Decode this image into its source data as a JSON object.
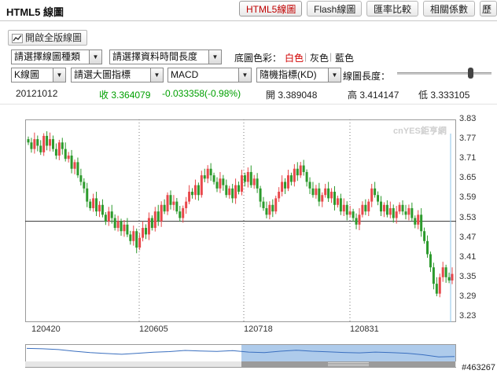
{
  "header": {
    "title": "HTML5 線圖",
    "tabs": [
      {
        "label": "HTML5線圖",
        "active": true
      },
      {
        "label": "Flash線圖",
        "active": false
      },
      {
        "label": "匯率比較",
        "active": false
      },
      {
        "label": "相關係數",
        "active": false
      },
      {
        "label": "歷",
        "active": false
      }
    ]
  },
  "toolbar": {
    "open_fullscreen_label": "開啟全版線圖",
    "chart_type_select": "請選擇線圖種類",
    "time_range_select": "請選擇資料時間長度",
    "bg_color_label": "底圖色彩：",
    "bg_colors": [
      "白色",
      "灰色",
      "藍色"
    ],
    "bg_selected": "白色",
    "kline_select": "K線圖",
    "main_indicator_select": "請選大圖指標",
    "macd_select": "MACD",
    "stochastic_select": "隨機指標(KD)",
    "line_length_label": "線圖長度：",
    "slider_level": 0.8
  },
  "quote": {
    "date": "20121012",
    "close": "收 3.364079",
    "change": "-0.033358(-0.98%)",
    "open": "開 3.389048",
    "high": "高 3.414147",
    "low": "低 3.333105"
  },
  "colors": {
    "up": "#e8484b",
    "down": "#2c9a2c",
    "nav_fill": "#aecbeb",
    "nav_line": "#3a6fbf"
  },
  "chart_data": {
    "type": "candlestick",
    "y_ticks": [
      "3.83",
      "3.77",
      "3.71",
      "3.65",
      "3.59",
      "3.53",
      "3.47",
      "3.41",
      "3.35",
      "3.29",
      "3.23"
    ],
    "ylim": [
      3.23,
      3.83
    ],
    "x_ticks": [
      "120420",
      "120605",
      "120718",
      "120831"
    ],
    "reference_line": 3.52,
    "watermark": "cnYES鉅亨網",
    "closes": [
      3.76,
      3.74,
      3.77,
      3.75,
      3.73,
      3.78,
      3.75,
      3.77,
      3.74,
      3.72,
      3.76,
      3.74,
      3.71,
      3.72,
      3.68,
      3.7,
      3.66,
      3.64,
      3.62,
      3.58,
      3.56,
      3.59,
      3.55,
      3.57,
      3.54,
      3.52,
      3.55,
      3.53,
      3.5,
      3.52,
      3.49,
      3.51,
      3.48,
      3.46,
      3.49,
      3.44,
      3.47,
      3.5,
      3.48,
      3.53,
      3.5,
      3.55,
      3.52,
      3.57,
      3.55,
      3.6,
      3.57,
      3.58,
      3.55,
      3.53,
      3.56,
      3.58,
      3.61,
      3.6,
      3.63,
      3.6,
      3.66,
      3.65,
      3.68,
      3.66,
      3.64,
      3.62,
      3.65,
      3.63,
      3.6,
      3.62,
      3.59,
      3.63,
      3.61,
      3.66,
      3.64,
      3.67,
      3.63,
      3.65,
      3.62,
      3.58,
      3.56,
      3.54,
      3.57,
      3.55,
      3.59,
      3.61,
      3.64,
      3.62,
      3.66,
      3.64,
      3.68,
      3.66,
      3.69,
      3.67,
      3.64,
      3.62,
      3.6,
      3.62,
      3.58,
      3.6,
      3.62,
      3.59,
      3.61,
      3.57,
      3.59,
      3.55,
      3.57,
      3.54,
      3.55,
      3.53,
      3.51,
      3.54,
      3.57,
      3.55,
      3.58,
      3.62,
      3.6,
      3.58,
      3.55,
      3.57,
      3.54,
      3.56,
      3.53,
      3.55,
      3.57,
      3.55,
      3.54,
      3.56,
      3.53,
      3.51,
      3.54,
      3.49,
      3.46,
      3.42,
      3.38,
      3.33,
      3.3,
      3.35,
      3.38,
      3.35,
      3.34,
      3.36
    ],
    "preview": [
      3.76,
      3.74,
      3.7,
      3.62,
      3.55,
      3.51,
      3.47,
      3.52,
      3.57,
      3.6,
      3.66,
      3.63,
      3.61,
      3.65,
      3.58,
      3.55,
      3.62,
      3.67,
      3.62,
      3.59,
      3.56,
      3.54,
      3.58,
      3.55,
      3.52,
      3.45,
      3.34,
      3.36
    ]
  },
  "footer": {
    "image_id": "#463267"
  }
}
